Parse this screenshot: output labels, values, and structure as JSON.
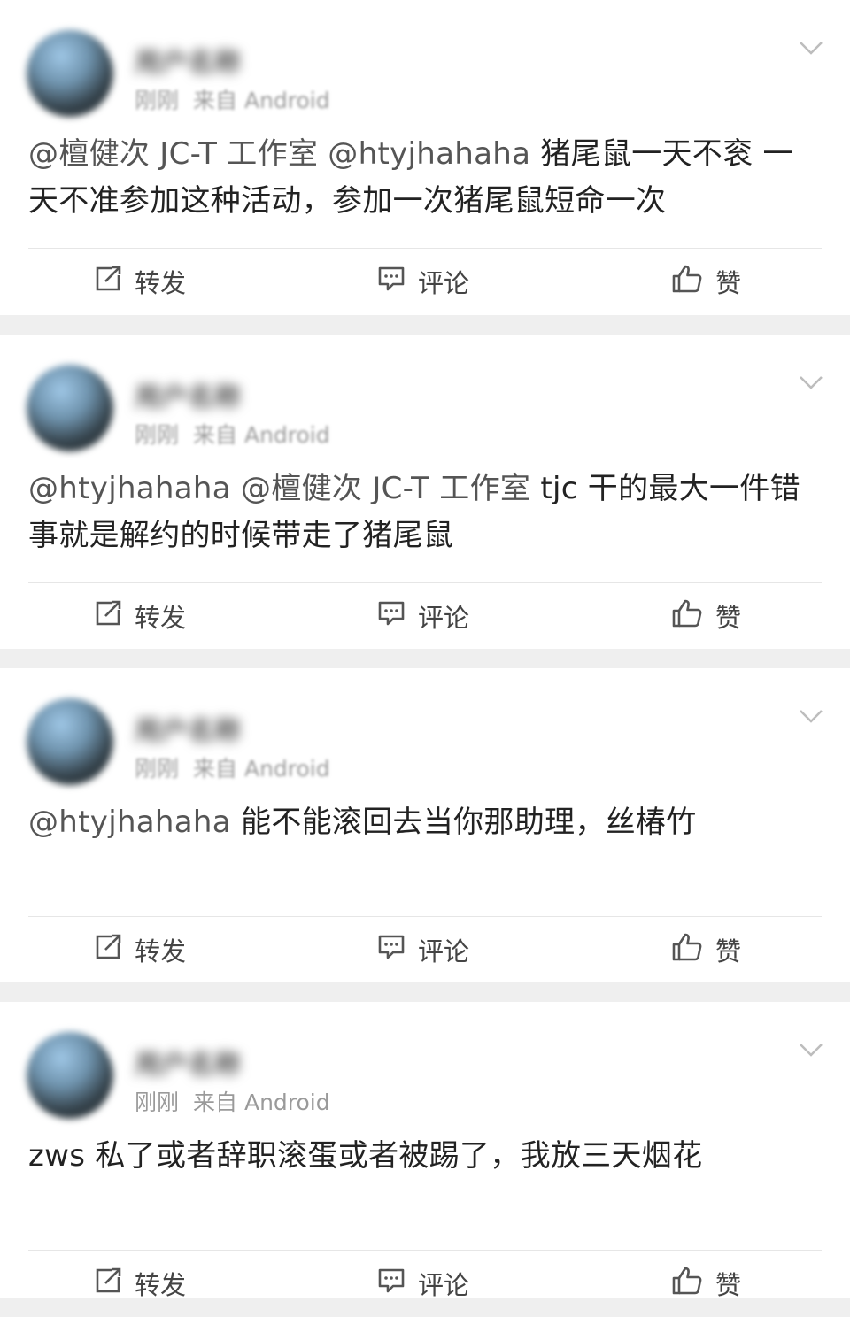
{
  "actions": {
    "repost": "转发",
    "comment": "评论",
    "like": "赞"
  },
  "posts": [
    {
      "username": "用户名称",
      "time": "刚刚",
      "source": "来自 Android",
      "segments": [
        {
          "text": "@檀健次 JC-T 工作室 @htyjhahaha ",
          "mention": true
        },
        {
          "text": "猪尾鼠一天不衮 一天不准参加这种活动，参加一次猪尾鼠短命一次",
          "mention": false
        }
      ]
    },
    {
      "username": "用户名称",
      "time": "刚刚",
      "source": "来自 Android",
      "segments": [
        {
          "text": "@htyjhahaha @檀健次 JC-T 工作室 ",
          "mention": true
        },
        {
          "text": "tjc 干的最大一件错事就是解约的时候带走了猪尾鼠",
          "mention": false
        }
      ]
    },
    {
      "username": "用户名称",
      "time": "刚刚",
      "source": "来自 Android",
      "segments": [
        {
          "text": "@htyjhahaha ",
          "mention": true
        },
        {
          "text": "能不能滚回去当你那助理，丝椿竹",
          "mention": false
        }
      ]
    },
    {
      "username": "用户名称",
      "time": "刚刚",
      "source": "来自 Android",
      "segments": [
        {
          "text": "zws 私了或者辞职滚蛋或者被踢了，我放三天烟花",
          "mention": false
        }
      ]
    }
  ]
}
